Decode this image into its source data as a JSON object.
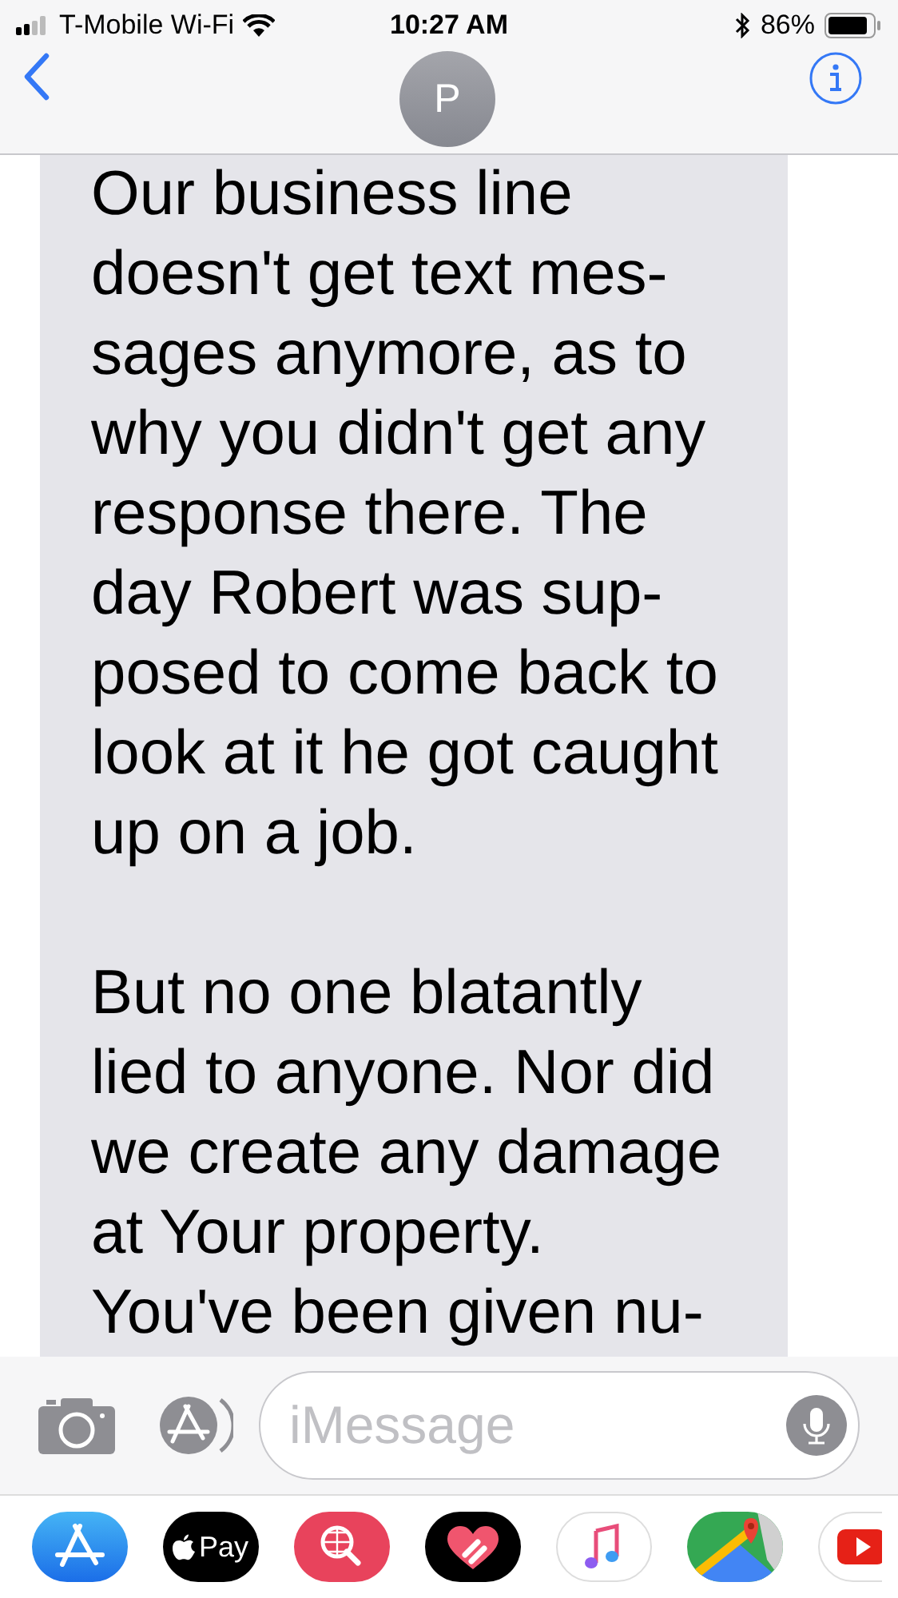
{
  "status_bar": {
    "carrier": "T-Mobile Wi-Fi",
    "time": "10:27 AM",
    "battery": "86%"
  },
  "header": {
    "avatar_initial": "P"
  },
  "messages": [
    {
      "kind": "received",
      "paragraphs": [
        [
          "Our business line",
          "doesn't get text mes-",
          "sages anymore, as to",
          "why you didn't get any",
          "response there. The",
          "day Robert was sup-",
          "posed to come back to",
          "look at it he got caught",
          "up on a job."
        ],
        [
          "But no one blatantly",
          "lied to anyone. Nor did",
          "we create any damage",
          "at Your property.",
          "You've been given nu-"
        ]
      ]
    }
  ],
  "compose": {
    "placeholder": "iMessage"
  },
  "app_drawer": {
    "pay_label": "Pay"
  }
}
